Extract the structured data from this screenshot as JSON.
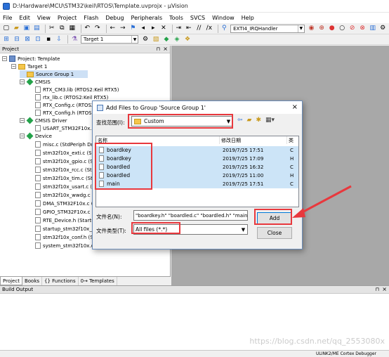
{
  "window": {
    "title": "D:\\Hardware\\MCU\\STM32\\keil\\RTOS\\Template.uvprojx - µVision"
  },
  "menu": [
    "File",
    "Edit",
    "View",
    "Project",
    "Flash",
    "Debug",
    "Peripherals",
    "Tools",
    "SVCS",
    "Window",
    "Help"
  ],
  "toolbar": {
    "function_combo": "EXTI4_IRQHandler",
    "target_combo": "Target 1"
  },
  "project_panel": {
    "title": "Project",
    "tree": {
      "root": "Project: Template",
      "target": "Target 1",
      "group": "Source Group 1",
      "cmsis": "CMSIS",
      "cmsis_items": [
        "RTX_CM3.lib (RTOS2:Keil RTX5)",
        "rtx_lib.c (RTOS2:Keil RTX5)",
        "RTX_Config.c (RTOS2",
        "RTX_Config.h (RTOS2"
      ],
      "cmsis_driver": "CMSIS Driver",
      "cmsis_driver_items": [
        "USART_STM32F10x.c"
      ],
      "device": "Device",
      "device_items": [
        "misc.c (StdPeriph Dri",
        "stm32f10x_exti.c (Std",
        "stm32f10x_gpio.c (St",
        "stm32f10x_rcc.c (StdP",
        "stm32f10x_tim.c (Std",
        "stm32f10x_usart.c (St",
        "stm32f10x_wwdg.c (S",
        "DMA_STM32F10x.c (S",
        "GPIO_STM32F10x.c (S",
        "RTE_Device.h (Startup",
        "startup_stm32f10x_m",
        "stm32f10x_conf.h (St",
        "system_stm32f10x.c ("
      ]
    },
    "tabs": [
      "Project",
      "Books",
      "{} Functions",
      "0→ Templates"
    ]
  },
  "build_output": {
    "title": "Build Output"
  },
  "status_bar": {
    "debugger": "ULINK2/ME Cortex Debugger",
    "watermark": "https://blog.csdn.net/qq_2553080x"
  },
  "dialog": {
    "title": "Add Files to Group 'Source Group 1'",
    "lookin_label": "查找范围(I):",
    "lookin_value": "Custom",
    "columns": {
      "name": "名称",
      "date": "修改日期",
      "type": "类"
    },
    "files": [
      {
        "name": "boardkey",
        "date": "2019/7/25 17:51",
        "type": "C"
      },
      {
        "name": "boardkey",
        "date": "2019/7/25 17:09",
        "type": "H"
      },
      {
        "name": "boardled",
        "date": "2019/7/25 16:32",
        "type": "C"
      },
      {
        "name": "boardled",
        "date": "2019/7/25 11:00",
        "type": "H"
      },
      {
        "name": "main",
        "date": "2019/7/25 17:51",
        "type": "C"
      }
    ],
    "filename_label": "文件名(N):",
    "filename_value": "\"boardkey.h\" \"boardled.c\" \"boardled.h\" \"main.c",
    "filetype_label": "文件类型(T):",
    "filetype_value": "All files (*.*)",
    "add_label": "Add",
    "close_label": "Close"
  },
  "colors": {
    "annotation_red": "#e8383d",
    "selection_blue": "#cce4f7",
    "editor_gray": "#a8a8a8"
  }
}
